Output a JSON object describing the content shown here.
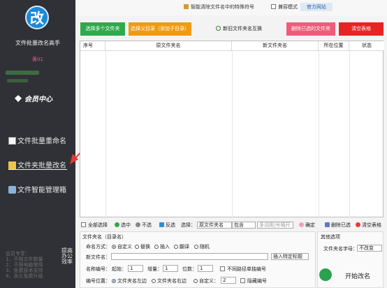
{
  "sidebar": {
    "logo": "改",
    "title": "文件批量改名高手",
    "version": "黄01",
    "member_label": "会员中心",
    "items": [
      {
        "label": "文件批量重命名"
      },
      {
        "label": "文件夹批量改名"
      },
      {
        "label": "文件智能管理箱"
      }
    ],
    "bottom_lines": [
      "会员专享：",
      "1、不限文件数量",
      "2、不限电脑使用",
      "3、免费技术支持",
      "4、永久免费升级"
    ],
    "vertical_text": "提高办公效率"
  },
  "topbar": {
    "special_chars": "智能清除文件名中的特殊符号",
    "compat_mode": "兼容模式",
    "official": "官方网站"
  },
  "toolbar": {
    "select_multi": "选择多个文件夹",
    "select_dir": "选择父目录（添加子目录）",
    "create_from_list": "新旧文件夹名互换",
    "delete_selected": "删除已选的文件夹",
    "clear_table": "清空表格"
  },
  "table": {
    "headers": [
      "序号",
      "原文件夹名",
      "新文件夹名",
      "所在位置",
      "状态"
    ]
  },
  "bottom_toolbar": {
    "select_all": "全部选择",
    "select_on": "选中",
    "deselect": "不选",
    "invert": "反选",
    "choose_label": "选择：",
    "choose_value": "原文件夹名",
    "contains": "包含",
    "multi_hint": "多词用|号隔开",
    "confirm": "确定",
    "delete_selected": "删除已选",
    "clear_table": "清空表格"
  },
  "panel": {
    "section_title": "文件夹名（目录名）",
    "mode_label": "命名方式：",
    "modes": [
      "自定义",
      "替换",
      "插入",
      "翻译",
      "随机"
    ],
    "new_name_label": "新文件名：",
    "insert_label": "插入特定标题",
    "numbering_label": "名称编号：",
    "start_label": "起始：",
    "start_value": "1",
    "step_label": "增量：",
    "step_value": "1",
    "digits_label": "位数：",
    "digits_value": "1",
    "diff_path_label": "不同路径单独编号",
    "position_label": "编号位置：",
    "position_left": "文件夹名左边",
    "position_right": "文件夹名右边",
    "custom_label": "自定义：",
    "custom_value": "2",
    "hide_label": "隐藏编号"
  },
  "other": {
    "title": "其他选项",
    "case_label": "文件夹名字母：",
    "case_value": "不改变",
    "start_button": "开始改名"
  }
}
